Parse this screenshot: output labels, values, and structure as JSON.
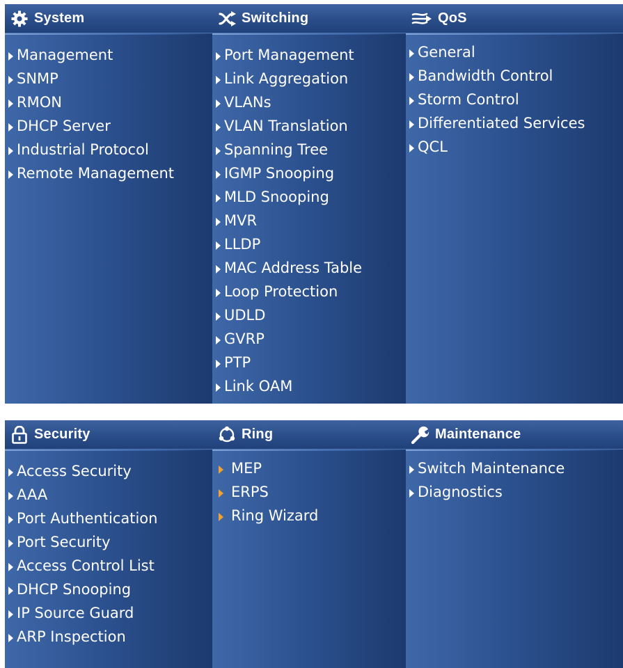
{
  "panels": [
    {
      "columns": [
        {
          "title": "System",
          "icon": "gear-icon",
          "items": [
            "Management",
            "SNMP",
            "RMON",
            "DHCP Server",
            "Industrial Protocol",
            "Remote Management"
          ]
        },
        {
          "title": "Switching",
          "icon": "switching-arrows-icon",
          "items": [
            "Port Management",
            "Link Aggregation",
            "VLANs",
            "VLAN Translation",
            "Spanning Tree",
            "IGMP Snooping",
            "MLD Snooping",
            "MVR",
            "LLDP",
            "MAC Address Table",
            "Loop Protection",
            "UDLD",
            "GVRP",
            "PTP",
            "Link OAM"
          ]
        },
        {
          "title": "QoS",
          "icon": "qos-waves-icon",
          "items": [
            "General",
            "Bandwidth Control",
            "Storm Control",
            "Differentiated Services",
            "QCL"
          ]
        }
      ]
    },
    {
      "columns": [
        {
          "title": "Security",
          "icon": "lock-icon",
          "items": [
            "Access Security",
            "AAA",
            "Port Authentication",
            "Port Security",
            "Access Control List",
            "DHCP Snooping",
            "IP Source Guard",
            "ARP Inspection"
          ]
        },
        {
          "title": "Ring",
          "icon": "ring-icon",
          "items": [
            "MEP",
            "ERPS",
            "Ring Wizard"
          ]
        },
        {
          "title": "Maintenance",
          "icon": "wrench-icon",
          "items": [
            "Switch Maintenance",
            "Diagnostics"
          ]
        }
      ]
    }
  ],
  "colors": {
    "panel_bg": "#2d5290",
    "text": "#ffffff",
    "arrow_default": "#ffffff",
    "arrow_ring": "#f0a131"
  }
}
